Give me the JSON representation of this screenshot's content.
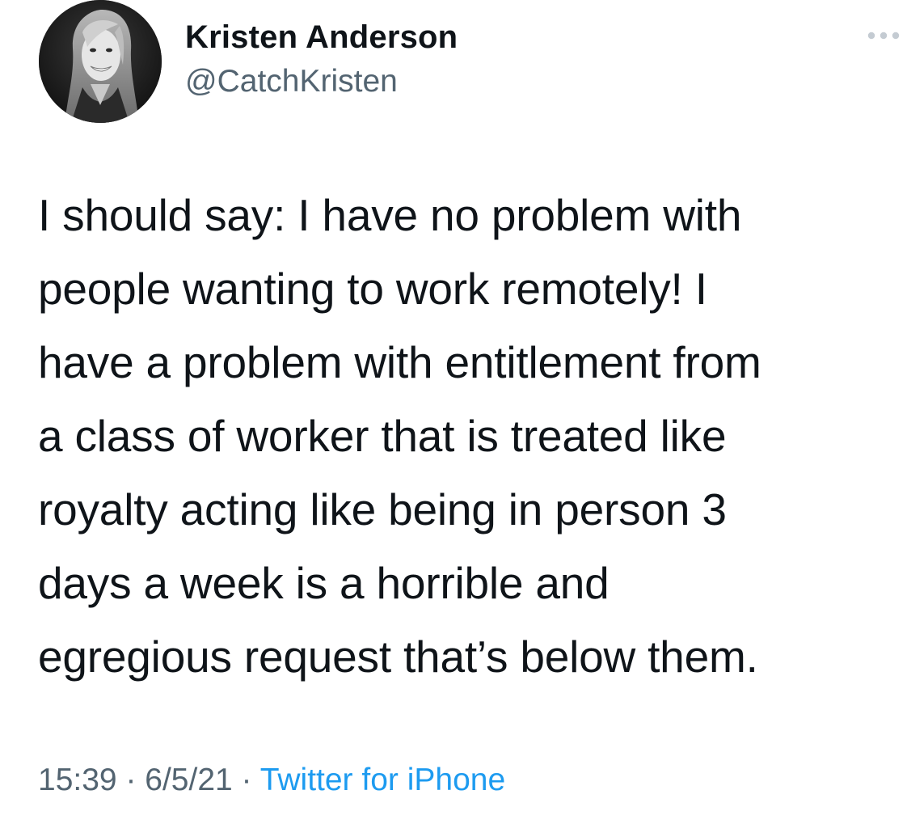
{
  "author": {
    "display_name": "Kristen Anderson",
    "handle": "@CatchKristen",
    "avatar_icon": "profile-photo"
  },
  "more_icon": "ellipsis-icon",
  "tweet": {
    "text": "I should say: I have no problem with\npeople wanting to work remotely! I\nhave a problem with entitlement from\na class of worker that is treated like\nroyalty acting like being in person 3\ndays a week is a horrible and\negregious request that’s below them."
  },
  "meta": {
    "time": "15:39",
    "separator": " · ",
    "date": "6/5/21",
    "source": "Twitter for iPhone"
  },
  "colors": {
    "text": "#0f1419",
    "secondary": "#536471",
    "link": "#1d9bf0",
    "background": "#ffffff"
  }
}
